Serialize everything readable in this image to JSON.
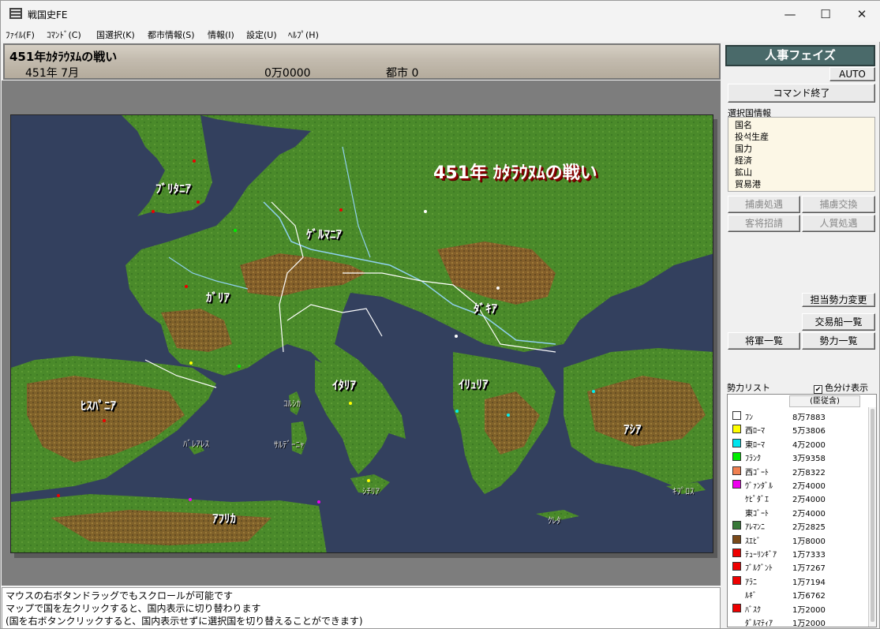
{
  "window": {
    "title": "戦国史FE",
    "minimize": "—",
    "maximize": "☐",
    "close": "✕"
  },
  "menu": [
    "ﾌｧｲﾙ(F)",
    "ｺﾏﾝﾄﾞ(C)",
    "国選択(K)",
    "都市情報(S)",
    "情報(I)",
    "設定(U)",
    "ﾍﾙﾌﾟ(H)"
  ],
  "header": {
    "title": "451年ｶﾀﾗｳﾇﾑの戦い",
    "date": "451年  7月",
    "gold": "0万0000",
    "cities": "都市  0"
  },
  "map": {
    "battle_title": "451年 ｶﾀﾗｳﾇﾑの戦い",
    "regions": [
      "ﾌﾞﾘﾀﾆｱ",
      "ｹﾞﾙﾏﾆｱ",
      "ｶﾞﾘｱ",
      "ﾀﾞｷｱ",
      "ﾋｽﾊﾟﾆｱ",
      "ｲﾀﾘｱ",
      "ｲﾘｭﾘｱ",
      "ｱｼｱ",
      "ｱﾌﾘｶ"
    ],
    "islands": [
      "ｺﾙｼｶ",
      "ﾊﾞﾚｱﾚｽ",
      "ｻﾙﾃﾞｰﾆｬ",
      "ｼﾁﾘｱ",
      "ｸﾚﾀ",
      "ｷﾌﾟﾛｽ"
    ]
  },
  "messages": [
    "マウスの右ボタンドラッグでもスクロールが可能です",
    "マップで国を左クリックすると、国内表示に切り替わります",
    "(国を右ボタンクリックすると、国内表示せずに選択国を切り替えることができます)"
  ],
  "panel": {
    "phase": "人事フェイズ",
    "auto": "AUTO",
    "end_command": "コマンド終了",
    "selected_info_label": "選択国情報",
    "selected_info": [
      "国名",
      "投석生産",
      "国力",
      "経済",
      "鉱山",
      "貿易港"
    ],
    "buttons": {
      "prisoner_treat": "捕虜処遇",
      "prisoner_exchange": "捕虜交換",
      "guest_general": "客将招請",
      "hostage": "人質処遇",
      "change_faction": "担当勢力変更",
      "trade_ships": "交易船一覧",
      "generals": "将軍一覧",
      "forces": "勢力一覧"
    },
    "faction_list_label": "勢力リスト",
    "color_toggle": "色分け表示",
    "list_header": "(臣従含)"
  },
  "factions": [
    {
      "name": "ﾌﾝ",
      "count": "8万7883",
      "color": "#ffffff"
    },
    {
      "name": "西ﾛｰﾏ",
      "count": "5万3806",
      "color": "#ffff00"
    },
    {
      "name": "東ﾛｰﾏ",
      "count": "4万2000",
      "color": "#00e5ee"
    },
    {
      "name": "ﾌﾗﾝｸ",
      "count": "3万9358",
      "color": "#00ee00"
    },
    {
      "name": "西ｺﾞｰﾄ",
      "count": "2万8322",
      "color": "#f08050"
    },
    {
      "name": "ｳﾞｧﾝﾀﾞﾙ",
      "count": "2万4000",
      "color": "#ee00ee"
    },
    {
      "name": "ｹﾋﾟﾀﾞｴ",
      "count": "2万4000",
      "color": ""
    },
    {
      "name": "東ｺﾞｰﾄ",
      "count": "2万4000",
      "color": ""
    },
    {
      "name": "ｱﾚﾏﾝﾆ",
      "count": "2万2825",
      "color": "#3a7a3a"
    },
    {
      "name": "ｽｴﾋﾞ",
      "count": "1万8000",
      "color": "#7a4a1a"
    },
    {
      "name": "ﾃｭｰﾘﾝｷﾞｱ",
      "count": "1万7333",
      "color": "#ee0000"
    },
    {
      "name": "ﾌﾞﾙｸﾞﾝﾄ",
      "count": "1万7267",
      "color": "#ee0000"
    },
    {
      "name": "ｱﾗﾆ",
      "count": "1万7194",
      "color": "#ee0000"
    },
    {
      "name": "ﾙｷﾞ",
      "count": "1万6762",
      "color": ""
    },
    {
      "name": "ﾊﾞｽｸ",
      "count": "1万2000",
      "color": "#ee0000"
    },
    {
      "name": "ﾀﾞﾙﾏﾃｨｱ",
      "count": "1万2000",
      "color": ""
    }
  ]
}
